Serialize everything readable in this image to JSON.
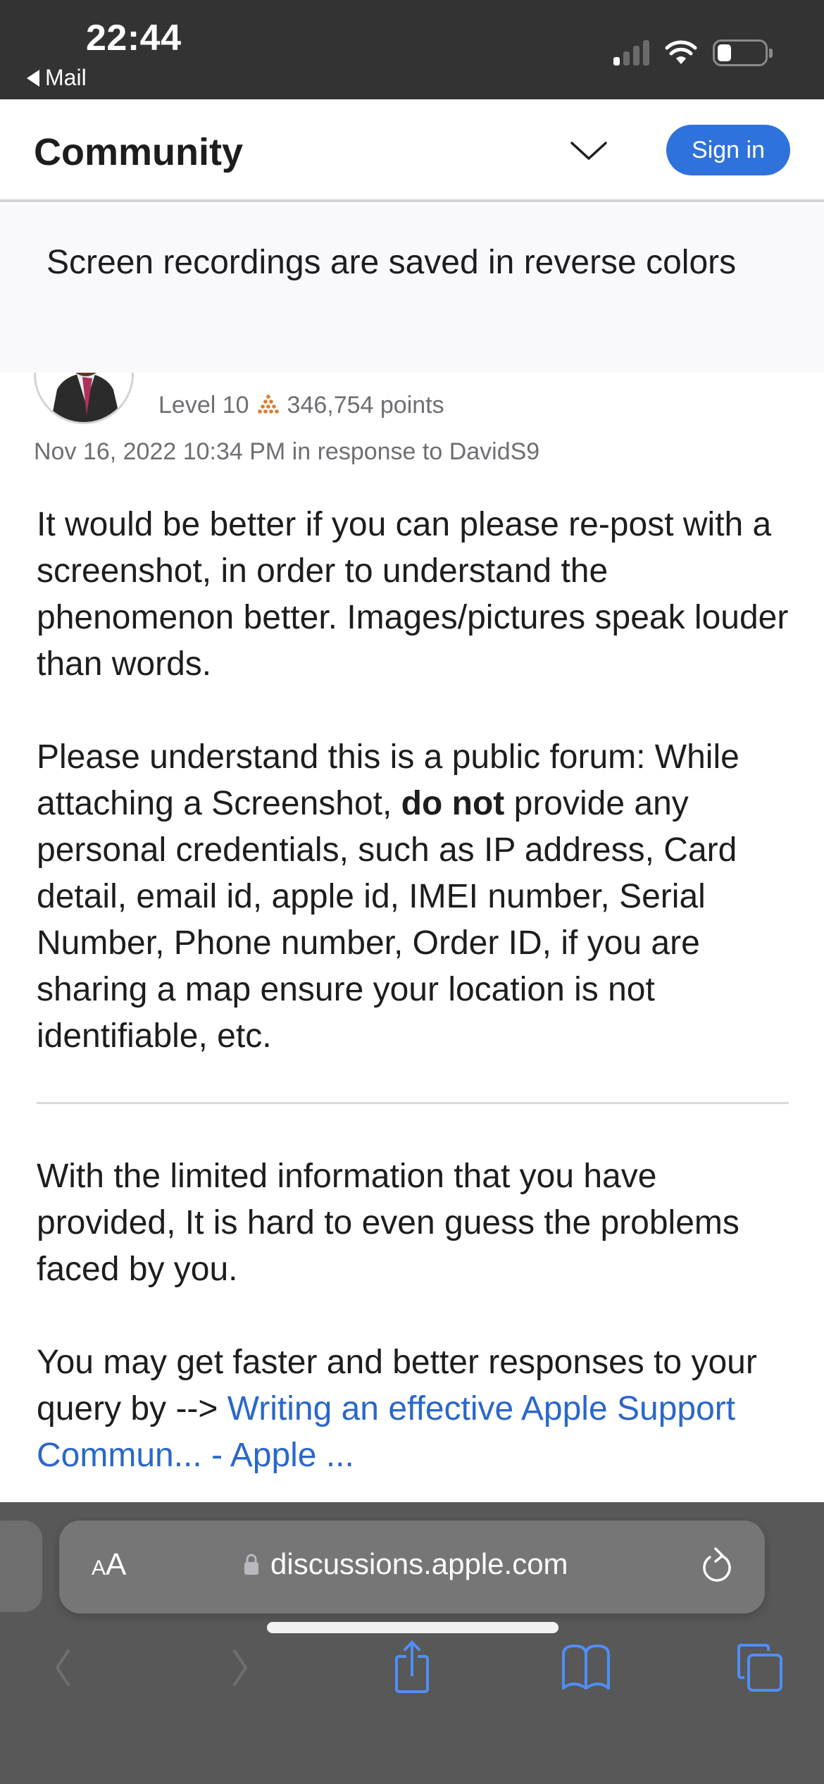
{
  "status_bar": {
    "time": "22:44",
    "back_app": "Mail",
    "icons": [
      "cellular-signal-icon",
      "wifi-icon",
      "battery-icon"
    ],
    "signal_bars_active": 1,
    "signal_bars_total": 4,
    "battery_level": 0.3
  },
  "header": {
    "title": "Community",
    "menu_icon": "chevron-down-icon",
    "signin_label": "Sign in",
    "accent_color": "#2f72dc"
  },
  "topic": {
    "title": "Screen recordings are saved in reverse colors"
  },
  "post": {
    "author": {
      "avatar": "avatar-photo",
      "level": "Level 10",
      "points_icon": "points-pyramid-icon",
      "points_color": "#e07b2e",
      "points": "346,754 points"
    },
    "date": "Nov 16, 2022 10:34 PM in response to DavidS9",
    "paragraphs": {
      "p1": "It would be better if you can please re-post with a screenshot, in order to understand the phenomenon better. Images/pictures speak louder than words.",
      "p2_a": "Please understand this is a public forum: While attaching a Screenshot, ",
      "p2_bold": "do not",
      "p2_b": " provide any personal credentials, such as IP address, Card detail, email id, apple id, IMEI number, Serial Number, Phone number, Order ID, if you are sharing a map ensure your location is not identifiable, etc.",
      "p3": "With the limited information that you have provided, It is hard to even guess the problems faced by you.",
      "p4_a": "You may get faster and better responses to your query by --> ",
      "p4_link": "Writing an effective Apple Support Commun... - Apple ..."
    },
    "link_color": "#2a67c9"
  },
  "browser": {
    "text_size_label_small": "A",
    "text_size_label_large": "A",
    "url": "discussions.apple.com",
    "lock_icon": "lock-icon",
    "reload_icon": "reload-icon",
    "toolbar": {
      "back": "back-chevron-icon",
      "forward": "forward-chevron-icon",
      "share": "share-icon",
      "bookmarks": "bookmarks-book-icon",
      "tabs": "tabs-icon"
    },
    "toolbar_accent": "#4f8ef7"
  }
}
